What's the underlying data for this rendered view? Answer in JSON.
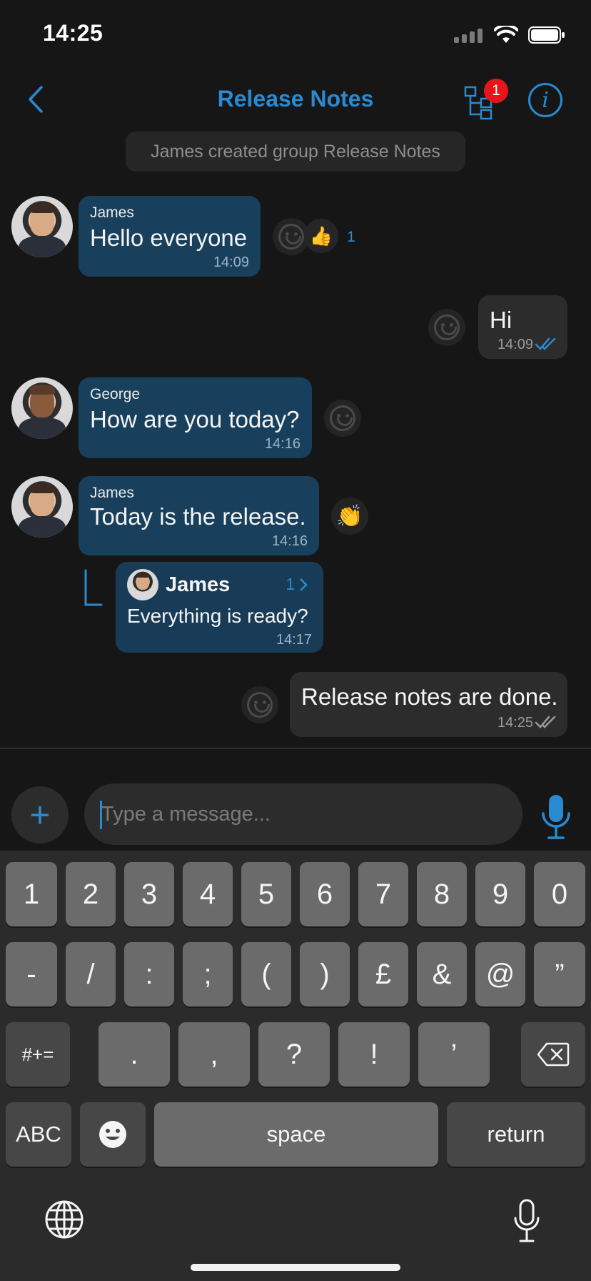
{
  "status_bar": {
    "time": "14:25"
  },
  "nav": {
    "title": "Release Notes",
    "badge": "1"
  },
  "system_message": "James created group Release Notes",
  "messages": [
    {
      "sender": "James",
      "text": "Hello everyone",
      "time": "14:09",
      "reaction": "👍",
      "reaction_count": "1"
    },
    {
      "text": "Hi",
      "time": "14:09"
    },
    {
      "sender": "George",
      "text": "How are you today?",
      "time": "14:16"
    },
    {
      "sender": "James",
      "text": "Today is the release.",
      "time": "14:16",
      "reaction": "👏"
    },
    {
      "sender": "James",
      "text": "Everything is ready?",
      "time": "14:17",
      "thread_count": "1"
    },
    {
      "text": "Release notes are done.",
      "time": "14:25"
    }
  ],
  "composer": {
    "placeholder": "Type a message..."
  },
  "keyboard": {
    "row1": [
      "1",
      "2",
      "3",
      "4",
      "5",
      "6",
      "7",
      "8",
      "9",
      "0"
    ],
    "row2": [
      "-",
      "/",
      ":",
      ";",
      "(",
      ")",
      "£",
      "&",
      "@",
      "”"
    ],
    "row3": [
      ".",
      ",",
      "?",
      "!",
      "’"
    ],
    "symbols_key": "#+=",
    "abc_key": "ABC",
    "space_key": "space",
    "return_key": "return"
  },
  "colors": {
    "accent": "#2a8ad1",
    "incoming_bubble": "#18405c",
    "outgoing_bubble": "#2c2c2c",
    "badge": "#e8141c"
  }
}
